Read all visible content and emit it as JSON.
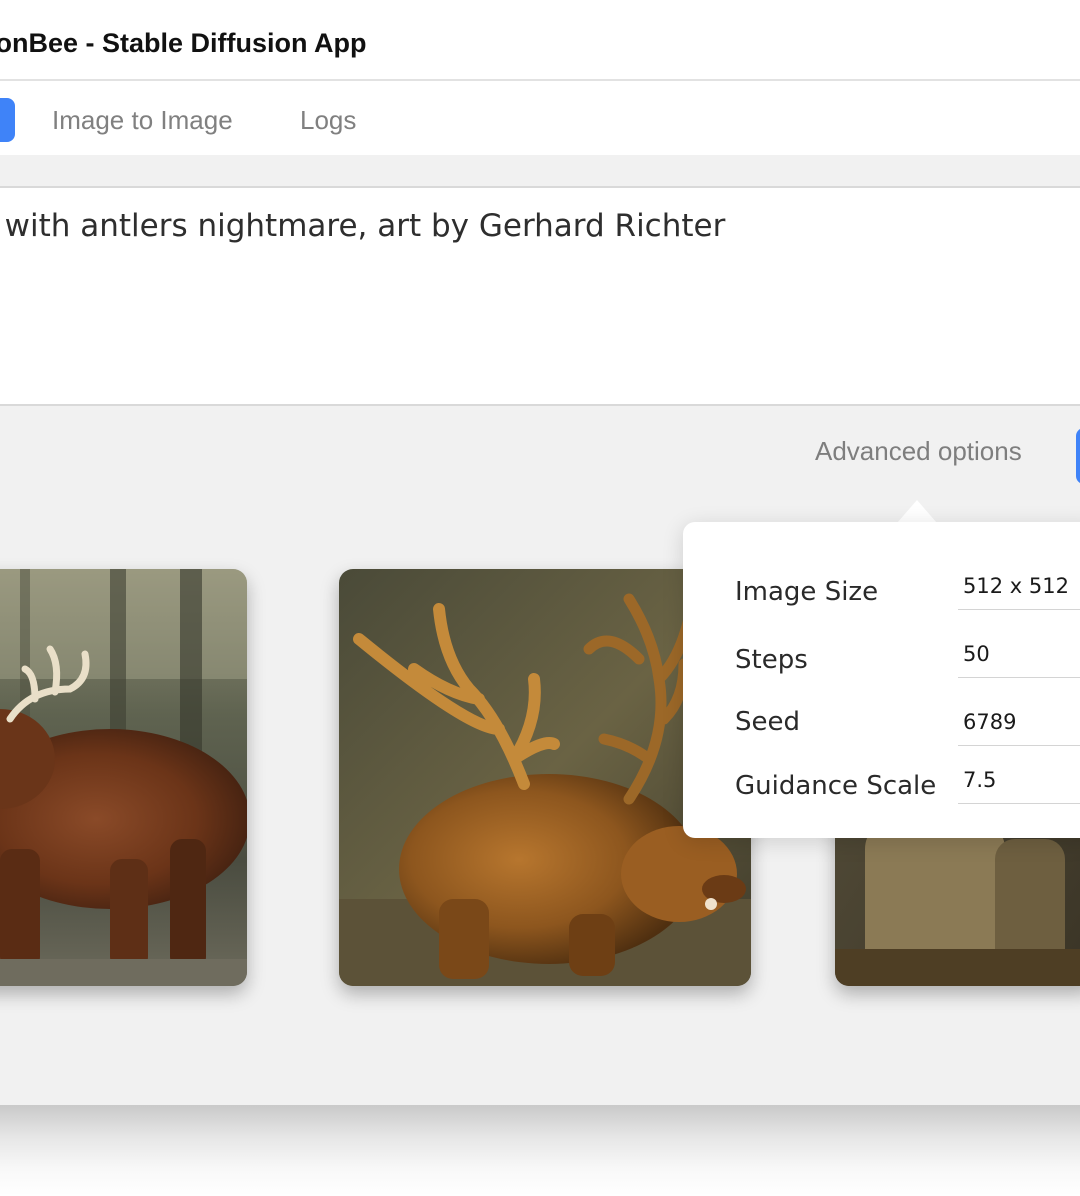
{
  "app": {
    "title": "ionBee - Stable Diffusion App"
  },
  "tabs": [
    {
      "label": "",
      "active": true
    },
    {
      "label": "Image to Image",
      "active": false
    },
    {
      "label": "Logs",
      "active": false
    }
  ],
  "prompt": {
    "value": "r with antlers nightmare, art by Gerhard Richter"
  },
  "advanced": {
    "link_label": "Advanced options"
  },
  "options": {
    "image_size": {
      "label": "Image Size",
      "value": "512 x 512"
    },
    "steps": {
      "label": "Steps",
      "value": "50"
    },
    "seed": {
      "label": "Seed",
      "value": "6789"
    },
    "guidance": {
      "label": "Guidance Scale",
      "value": "7.5"
    }
  },
  "colors": {
    "accent": "#3f83f8",
    "background": "#f1f1f1"
  }
}
